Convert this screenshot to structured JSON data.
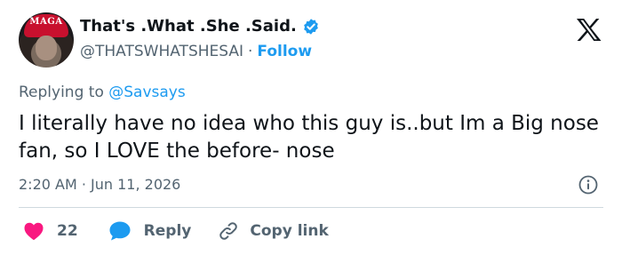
{
  "author": {
    "display_name": "That's .What .She .Said.",
    "handle": "@THATSWHATSHESAI",
    "separator": "·",
    "follow_label": "Follow",
    "avatar_hat_text": "MAGA"
  },
  "reply_context": {
    "prefix": "Replying to",
    "mention": "@Savsays"
  },
  "tweet": {
    "text": "I literally have no idea who this guy is..but Im a Big nose fan, so I LOVE the before- nose",
    "timestamp": "2:20 AM · Jun 11, 2026"
  },
  "actions": {
    "like_count": "22",
    "reply_label": "Reply",
    "copy_label": "Copy link"
  },
  "colors": {
    "accent": "#1d9bf0",
    "like": "#f91880",
    "text": "#0f1419",
    "muted": "#536471"
  },
  "icons": {
    "verified": "verified-badge-icon",
    "logo": "x-logo-icon",
    "info": "info-icon",
    "like": "heart-icon",
    "reply": "speech-bubble-icon",
    "copy": "link-icon"
  }
}
